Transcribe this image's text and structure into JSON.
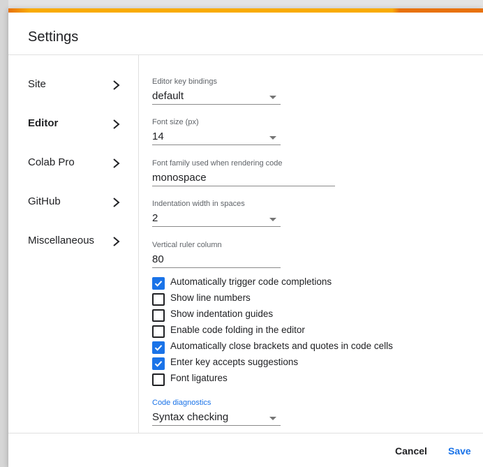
{
  "dialog": {
    "title": "Settings"
  },
  "nav": {
    "items": [
      {
        "label": "Site"
      },
      {
        "label": "Editor"
      },
      {
        "label": "Colab Pro"
      },
      {
        "label": "GitHub"
      },
      {
        "label": "Miscellaneous"
      }
    ],
    "active": "Editor"
  },
  "editor": {
    "key_bindings": {
      "label": "Editor key bindings",
      "value": "default"
    },
    "font_size": {
      "label": "Font size (px)",
      "value": "14"
    },
    "font_family": {
      "label": "Font family used when rendering code",
      "value": "monospace"
    },
    "indentation": {
      "label": "Indentation width in spaces",
      "value": "2"
    },
    "ruler": {
      "label": "Vertical ruler column",
      "value": "80"
    },
    "checkboxes": [
      {
        "label": "Automatically trigger code completions",
        "checked": true
      },
      {
        "label": "Show line numbers",
        "checked": false
      },
      {
        "label": "Show indentation guides",
        "checked": false
      },
      {
        "label": "Enable code folding in the editor",
        "checked": false
      },
      {
        "label": "Automatically close brackets and quotes in code cells",
        "checked": true
      },
      {
        "label": "Enter key accepts suggestions",
        "checked": true
      },
      {
        "label": "Font ligatures",
        "checked": false
      }
    ],
    "diagnostics": {
      "label": "Code diagnostics",
      "value": "Syntax checking"
    }
  },
  "footer": {
    "cancel_label": "Cancel",
    "save_label": "Save"
  },
  "colors": {
    "accent": "#1a73e8",
    "top_bar_orange": "#e8710a",
    "top_bar_yellow": "#f9ab00"
  },
  "icons": {
    "nav_chevron": "chevron-right-icon",
    "dropdown_arrow": "caret-down-icon",
    "checkbox_check": "check-icon"
  }
}
